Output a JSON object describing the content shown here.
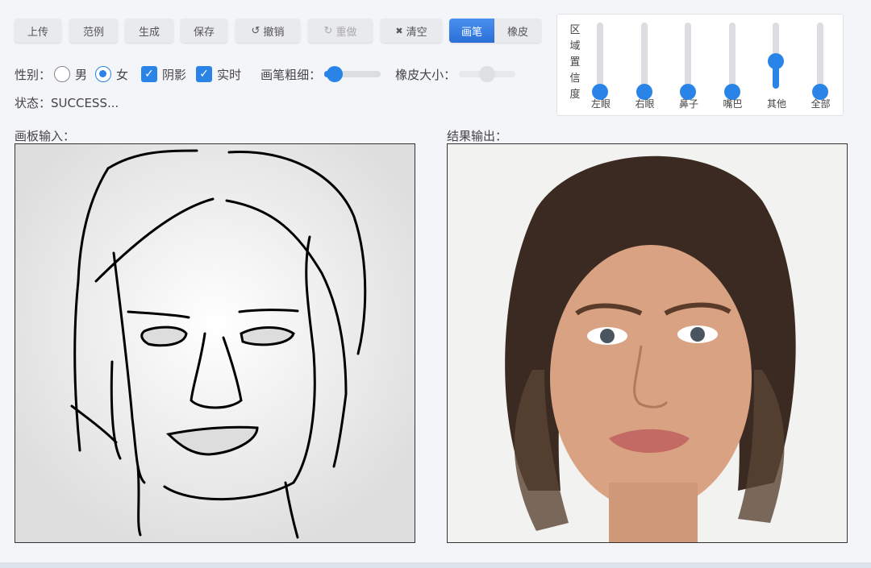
{
  "toolbar": {
    "upload": "上传",
    "examples": "范例",
    "generate": "生成",
    "save": "保存",
    "undo": "撤销",
    "redo": "重做",
    "clear": "清空",
    "brush": "画笔",
    "eraser": "橡皮",
    "undo_icon": "↺",
    "redo_icon": "↻",
    "clear_icon": "✖"
  },
  "options": {
    "gender_label": "性别：",
    "male": "男",
    "female": "女",
    "gender_selected": "女",
    "shadow": "阴影",
    "shadow_checked": true,
    "realtime": "实时",
    "realtime_checked": true,
    "brush_size_label": "画笔粗细：",
    "brush_size": 0.1,
    "eraser_size_label": "橡皮大小：",
    "eraser_size": 0.5
  },
  "status": "状态：SUCCESS...",
  "confidence": {
    "title": "区域置信度",
    "sliders": [
      {
        "label": "左眼",
        "value": 0
      },
      {
        "label": "右眼",
        "value": 0
      },
      {
        "label": "鼻子",
        "value": 0
      },
      {
        "label": "嘴巴",
        "value": 0
      },
      {
        "label": "其他",
        "value": 0.5
      },
      {
        "label": "全部",
        "value": 0
      }
    ]
  },
  "canvas": {
    "input_label": "画板输入：",
    "output_label": "结果输出："
  },
  "colors": {
    "accent": "#2a84e8"
  }
}
